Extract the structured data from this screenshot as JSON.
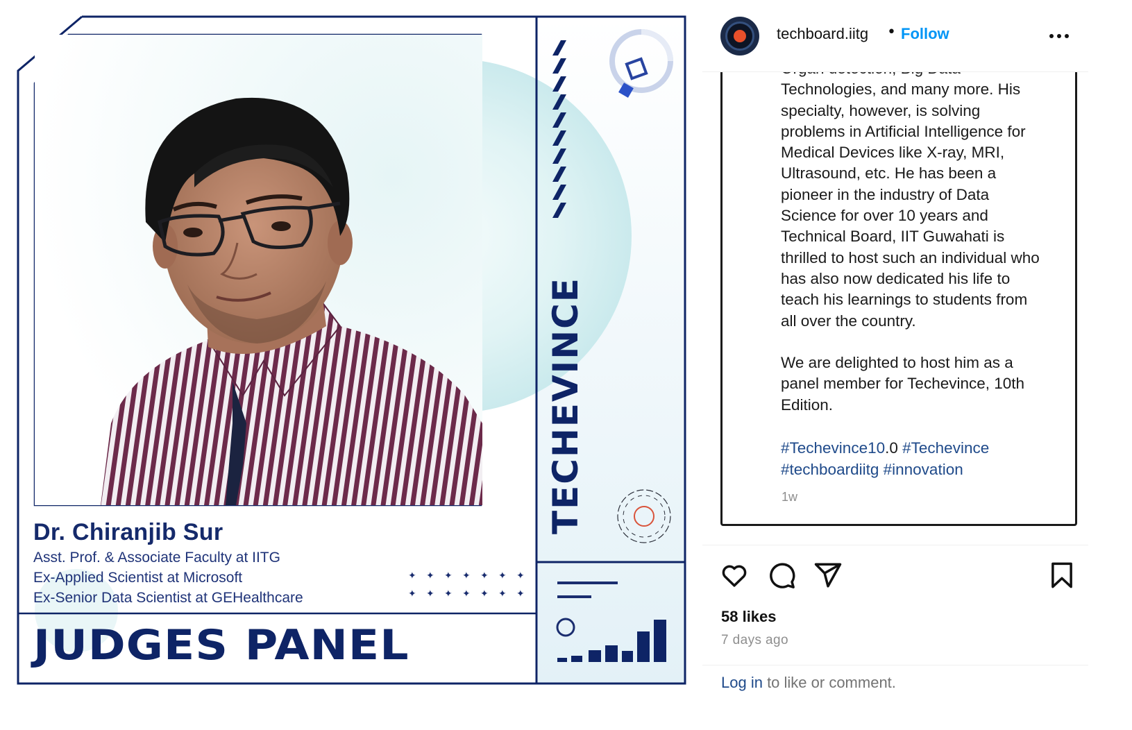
{
  "post": {
    "name": "Dr. Chiranjib Sur",
    "roles": [
      "Asst. Prof. & Associate Faculty at IITG",
      "Ex-Applied Scientist at Microsoft",
      "Ex-Senior Data Scientist at GEHealthcare"
    ],
    "banner": "JUDGES PANEL",
    "brand": "TECHEVINCE"
  },
  "header": {
    "username": "techboard.iitg",
    "separator": "•",
    "follow_label": "Follow"
  },
  "caption": {
    "lines": [
      "Organ detection, Big Data",
      "Technologies, and many more. His",
      "specialty, however, is solving",
      "problems in Artificial Intelligence for",
      "Medical Devices like X-ray, MRI,",
      "Ultrasound, etc. He has been a",
      "pioneer in the industry of Data",
      "Science for over 10 years and",
      "Technical Board, IIT Guwahati is",
      "thrilled to host such an individual who",
      "has also now dedicated his life to",
      "teach his learnings to students from",
      "all over the country."
    ],
    "lines_2": [
      "We are delighted to host him as a",
      "panel member for Techevince, 10th",
      "Edition."
    ],
    "hashtags": {
      "tag_1": "#Techevince10",
      "tag_1_suffix": ".0",
      "tag_2": "#Techevince",
      "tag_3": "#techboardiitg",
      "tag_4": "#innovation"
    },
    "time_short": "1w"
  },
  "actions": {
    "like_icon": "heart-icon",
    "comment_icon": "comment-icon",
    "share_icon": "share-icon",
    "save_icon": "bookmark-icon"
  },
  "stats": {
    "likes": "58 likes",
    "time_ago": "7 days ago"
  },
  "footer": {
    "login_label": "Log in",
    "login_suffix": " to like or comment."
  },
  "colors": {
    "navy": "#0e2466",
    "link": "#0095f6",
    "hashtag": "#1f4a8a",
    "muted": "#8e8e8e"
  }
}
